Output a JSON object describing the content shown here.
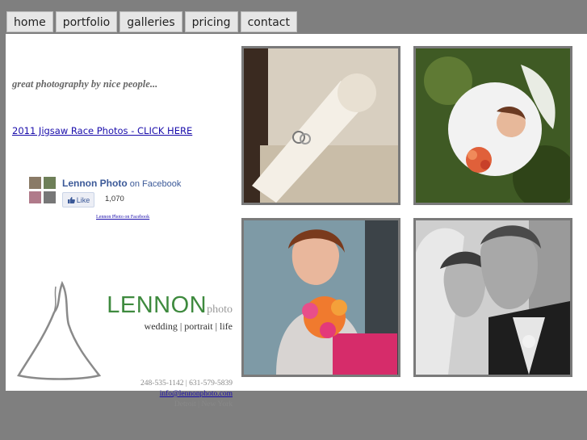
{
  "nav": {
    "items": [
      {
        "label": "home"
      },
      {
        "label": "portfolio"
      },
      {
        "label": "galleries"
      },
      {
        "label": "pricing"
      },
      {
        "label": "contact"
      }
    ]
  },
  "intro": {
    "tagline": "great photography by nice people...",
    "race_link": "2011 Jigsaw Race Photos - CLICK HERE"
  },
  "facebook": {
    "page_name": "Lennon Photo",
    "suffix": "on Facebook",
    "like_label": "Like",
    "like_count": "1,070",
    "small_link": "Lennon Photo on Facebook"
  },
  "brand": {
    "name": "LENNON",
    "name_suffix": "photo",
    "services": "wedding | portrait | life",
    "phones": "248-535-1142 | 631-579-5839",
    "email": "info@lennonphoto.com",
    "location": "Detroit | New York",
    "accent_color": "#3e8a3e"
  },
  "photos": [
    {
      "subject": "rings-on-bouquet"
    },
    {
      "subject": "bride-from-above"
    },
    {
      "subject": "bride-with-flowers"
    },
    {
      "subject": "couple-black-white"
    }
  ]
}
